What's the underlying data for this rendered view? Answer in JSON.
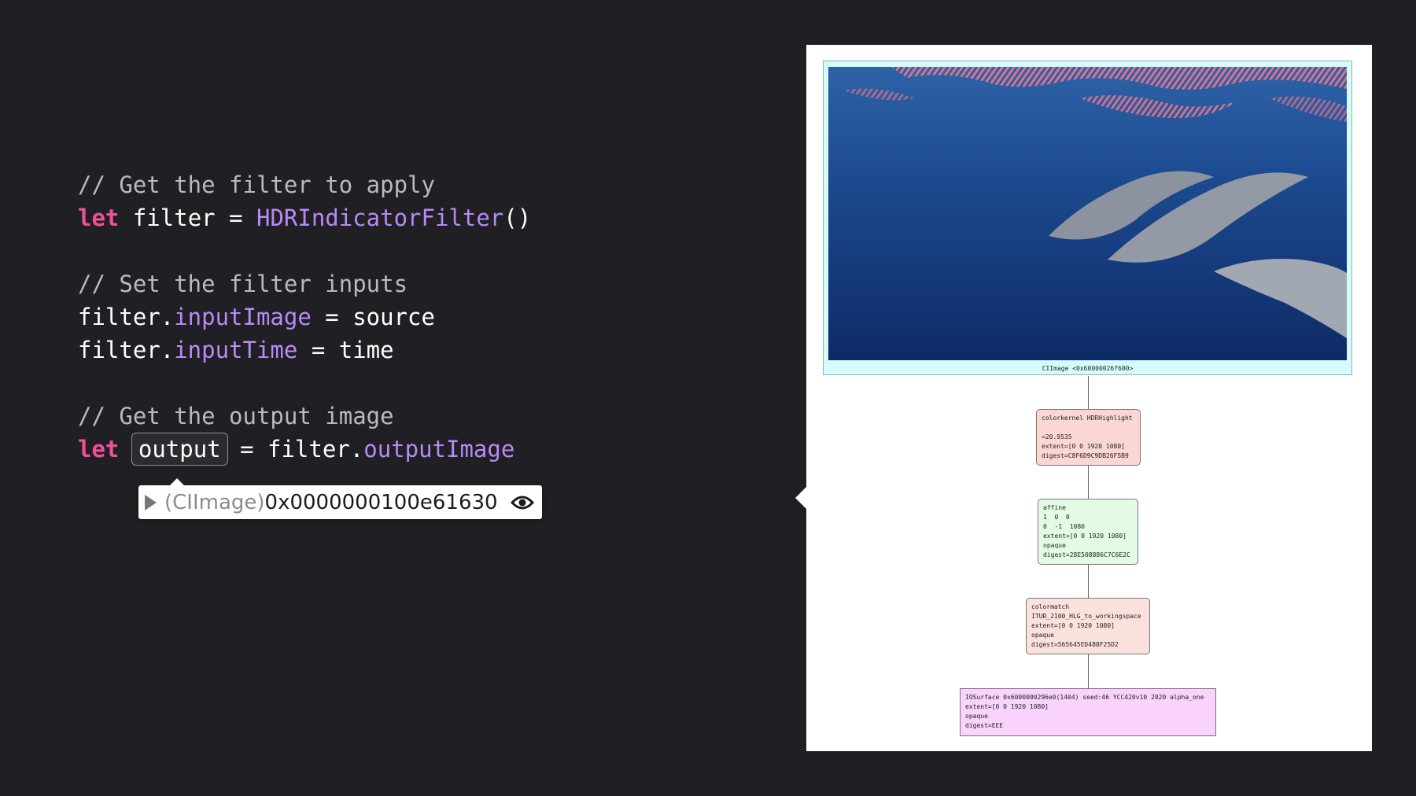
{
  "code": {
    "line1": {
      "comment": "// Get the filter to apply"
    },
    "line2": {
      "kw": "let",
      "name": " filter = ",
      "type": "HDRIndicatorFilter",
      "tail": "()"
    },
    "line3": {
      "comment": "// Set the filter inputs"
    },
    "line4": {
      "obj": "filter.",
      "prop": "inputImage",
      "tail": " = source"
    },
    "line5": {
      "obj": "filter.",
      "prop": "inputTime",
      "tail": " = time"
    },
    "line6": {
      "comment": "// Get the output image"
    },
    "line7": {
      "kw": "let",
      "var": "output",
      "mid": " = filter.",
      "prop": "outputImage"
    }
  },
  "popover": {
    "type": "(CIImage)",
    "address": "0x0000000100e61630",
    "expand_icon": "disclosure-triangle-icon",
    "quicklook_icon": "eye-icon"
  },
  "graph": {
    "image_caption": "CIImage <0x60000026f600>",
    "colorkernel": "colorkernel HDRHighlight\n\n=20.9535\nextent=[0 0 1920 1080]\ndigest=C8F6D9C9DB26F5B9",
    "affine": "affine\n1  0  0\n0  -1  1080\nextent=[0 0 1920 1080]\nopaque\ndigest=28E508886C7C6E2C",
    "colormatch": "colormatch\nITUR_2100_HLG_to_workingspace\nextent=[0 0 1920 1080]\nopaque\ndigest=565645ED488F25D2",
    "iosurface": "IOSurface 0x6000000296e0(1404) seed:46 YCC420v10 2020 alpha_one\nextent=[0 0 1920 1080]\nopaque\ndigest=EEE"
  },
  "colors": {
    "background": "#1f1f24",
    "keyword": "#f0509a",
    "type": "#b98af5",
    "comment": "#b9b9c0"
  }
}
